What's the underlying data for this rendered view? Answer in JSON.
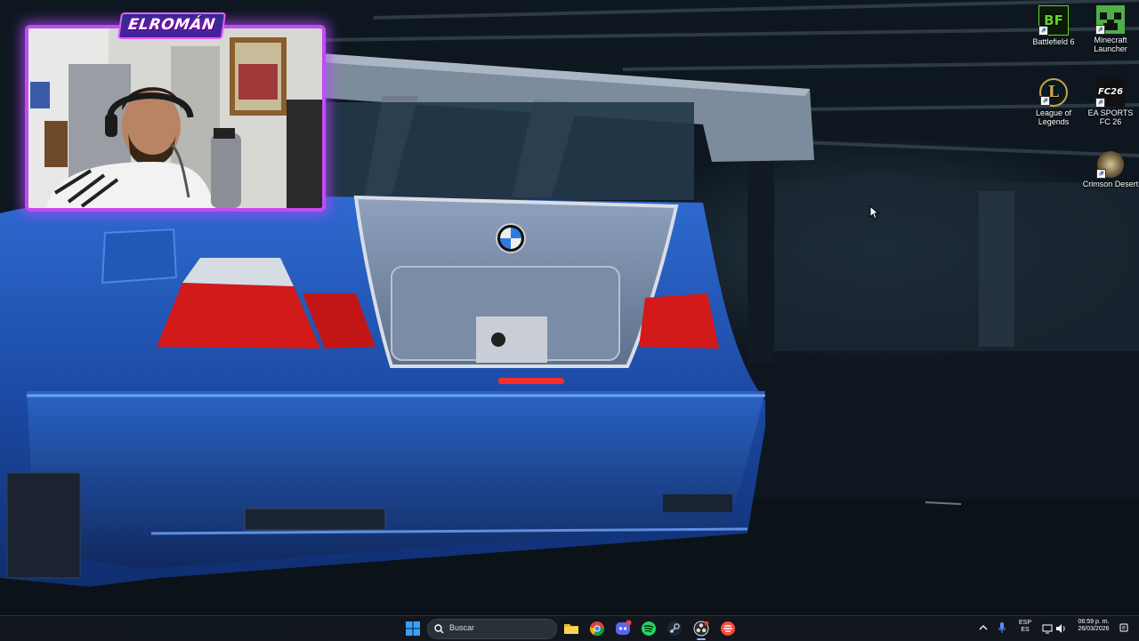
{
  "webcam": {
    "badge": "ELROMÁN"
  },
  "desktop_icons": [
    {
      "label": "Battlefield 6",
      "icon": "battlefield-6-icon",
      "glyph": "BF",
      "color": "#64d22a"
    },
    {
      "label": "Minecraft Launcher",
      "icon": "minecraft-launcher-icon",
      "color": "#3fa53a"
    },
    {
      "label": "League of Legends",
      "icon": "league-of-legends-icon",
      "glyph": "L",
      "color": "#c8a24a"
    },
    {
      "label": "EA SPORTS FC 26",
      "icon": "ea-sports-fc-26-icon",
      "glyph": "FC26",
      "color": "#ffffff"
    },
    {
      "label": "Crimson Desert",
      "icon": "crimson-desert-icon",
      "color": "#b49a70"
    }
  ],
  "taskbar": {
    "search_placeholder": "Buscar",
    "pinned": [
      "windows-start-icon",
      "file-explorer-icon",
      "chrome-icon",
      "discord-icon",
      "spotify-icon",
      "steam-icon",
      "obs-icon",
      "ea-app-icon"
    ],
    "tray": {
      "language_top": "ESP",
      "language_bottom": "ES",
      "time": "06:59 p. m.",
      "date": "26/03/2026"
    }
  },
  "colors": {
    "car_blue": "#1f4fa8",
    "webcam_border": "#c24cf0",
    "taillight": "#d21a1a"
  }
}
